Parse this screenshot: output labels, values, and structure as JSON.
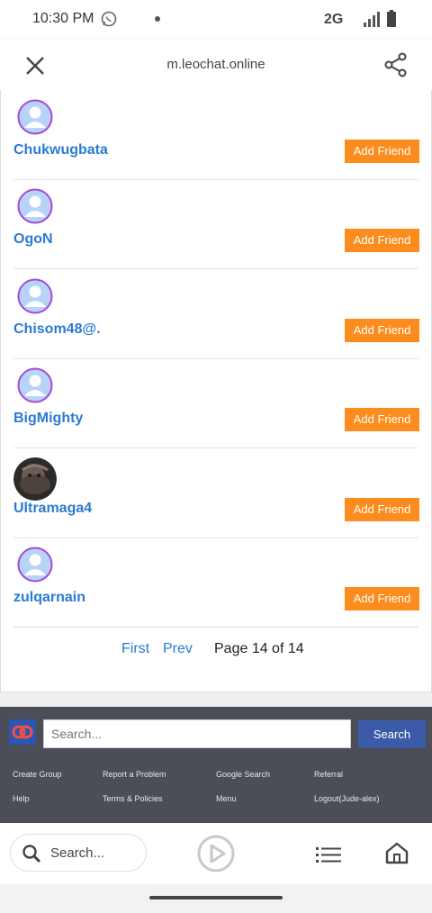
{
  "status": {
    "time": "10:30 PM",
    "network": "2G"
  },
  "browser": {
    "url": "m.leochat.online"
  },
  "users": [
    {
      "name": "Chukwugbata",
      "action": "Add Friend",
      "avatar": "default-avatar"
    },
    {
      "name": "OgoN",
      "action": "Add Friend",
      "avatar": "default-avatar"
    },
    {
      "name": "Chisom48@.",
      "action": "Add Friend",
      "avatar": "default-avatar"
    },
    {
      "name": "BigMighty",
      "action": "Add Friend",
      "avatar": "default-avatar"
    },
    {
      "name": "Ultramaga4",
      "action": "Add Friend",
      "avatar": "photo-avatar"
    },
    {
      "name": "zulqarnain",
      "action": "Add Friend",
      "avatar": "default-avatar"
    }
  ],
  "pagination": {
    "first": "First",
    "prev": "Prev",
    "info": "Page 14 of 14"
  },
  "footer": {
    "search_placeholder": "Search...",
    "search_button": "Search",
    "links": [
      "Create Group",
      "Report a Problem",
      "Google Search",
      "Referral",
      "Help",
      "Terms & Policies",
      "Menu",
      "Logout(Jude-alex)"
    ]
  },
  "bottombar": {
    "search_text": "Search..."
  },
  "colors": {
    "accent": "#fb8c1d",
    "link": "#2a7ad2",
    "footer_bg": "#4b4e56",
    "search_btn": "#3b5ba8"
  }
}
